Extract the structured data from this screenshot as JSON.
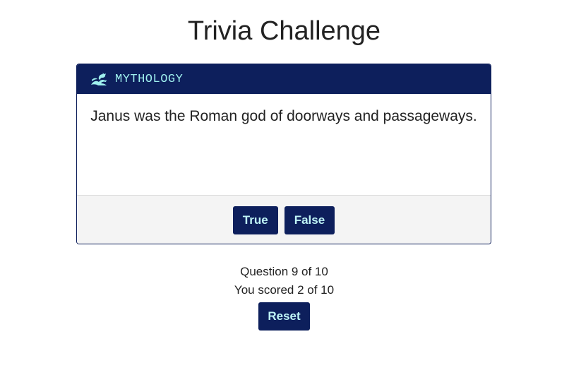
{
  "page": {
    "title": "Trivia Challenge"
  },
  "card": {
    "category_icon": "dragon-icon",
    "category": "MYTHOLOGY",
    "question": "Janus was the Roman god of doorways and passageways.",
    "answers": {
      "true_label": "True",
      "false_label": "False"
    }
  },
  "status": {
    "progress": "Question 9 of 10",
    "score": "You scored 2 of 10"
  },
  "controls": {
    "reset_label": "Reset"
  },
  "colors": {
    "primary": "#0d1f5c",
    "accent_text": "#9ff0ee",
    "footer_bg": "#f4f4f4"
  }
}
